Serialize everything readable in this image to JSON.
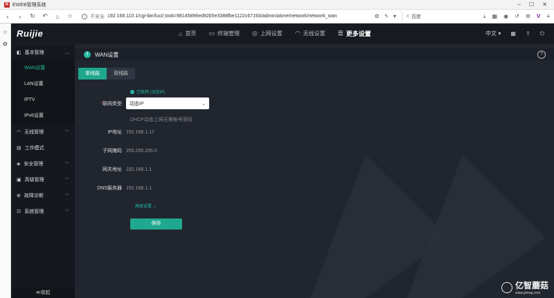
{
  "browser": {
    "tab_title": "EWEB管理系统",
    "favicon": "R",
    "insecure_label": "不安全",
    "url": "192.168.110.1/cgi-bin/luci/;stok=98145896ed92b5e3388fbe1122c67193/admin/alone/network/network_wan",
    "search_placeholder": "百度"
  },
  "app": {
    "logo": "Ruijie",
    "nav": [
      {
        "label": "首页",
        "icon": "home-icon"
      },
      {
        "label": "终端管理",
        "icon": "devices-icon"
      },
      {
        "label": "上网设置",
        "icon": "globe-icon"
      },
      {
        "label": "无线设置",
        "icon": "wifi-icon"
      },
      {
        "label": "更多设置",
        "icon": "sliders-icon"
      }
    ],
    "language": "中文"
  },
  "sidebar": {
    "groups": [
      {
        "label": "基本管理",
        "icon": "base-icon"
      },
      {
        "label": "无线管理",
        "icon": "wireless-icon"
      },
      {
        "label": "工作模式",
        "icon": "mode-icon"
      },
      {
        "label": "安全管理",
        "icon": "shield-icon"
      },
      {
        "label": "高级管理",
        "icon": "advanced-icon"
      },
      {
        "label": "故障诊断",
        "icon": "diagnose-icon"
      },
      {
        "label": "系统管理",
        "icon": "system-icon"
      }
    ],
    "sub_items": [
      "WAN设置",
      "LAN设置",
      "IPTV",
      "IPv6设置"
    ],
    "collapse_label": "≪收起"
  },
  "page": {
    "title": "WAN设置",
    "tabs": [
      "单线路",
      "双线路"
    ],
    "status": "已联网 (动态IP)",
    "form": {
      "type_label": "联网类型",
      "type_value": "动态IP",
      "hint": "DHCP动态上网无需帐号密码",
      "ip_label": "IP地址",
      "ip_value": "192.168.1.17",
      "mask_label": "子网掩码",
      "mask_value": "255.255.255.0",
      "gw_label": "网关地址",
      "gw_value": "192.168.1.1",
      "dns_label": "DNS服务器",
      "dns_value": "192.168.1.1",
      "advanced": "高级设置",
      "save": "保存"
    }
  },
  "watermark": {
    "text": "亿智蘑菇",
    "url": "www.yimog.com"
  }
}
